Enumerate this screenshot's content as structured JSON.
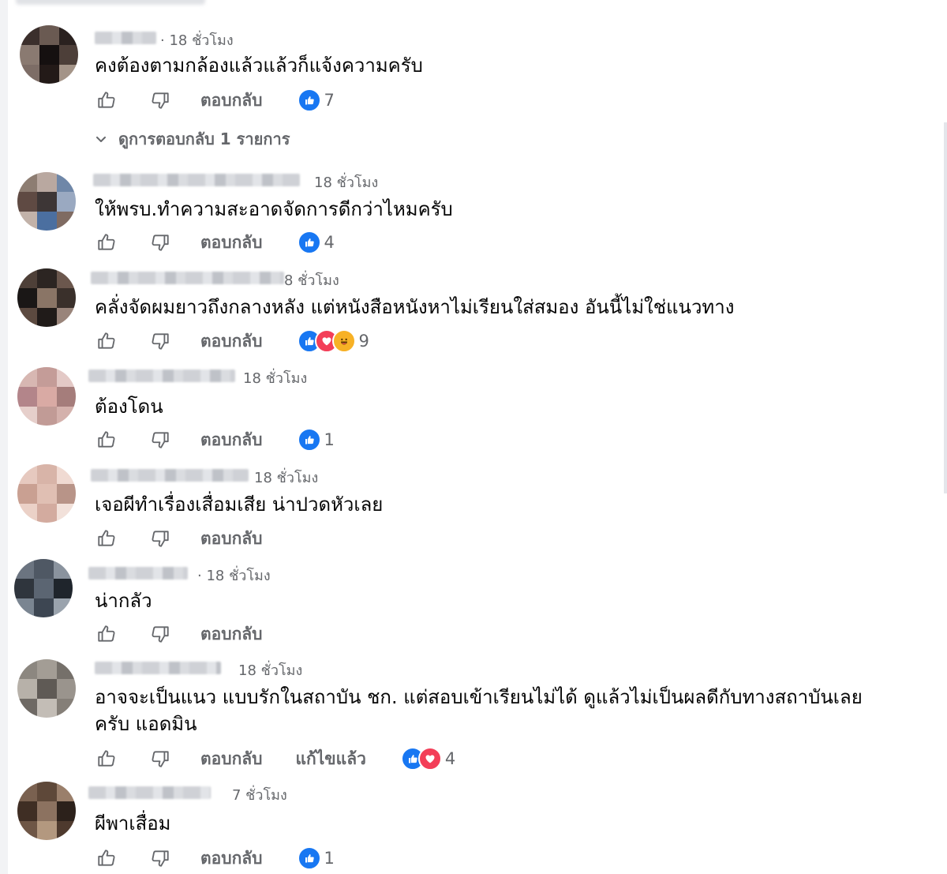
{
  "colors": {
    "accent": "#1877f2",
    "love": "#f33e58",
    "haha": "#f7b125",
    "muted": "#65676b"
  },
  "actions": {
    "like_icon": "thumbs-up-outline-icon",
    "dislike_icon": "thumbs-down-outline-icon",
    "reply": "ตอบกลับ",
    "edited": "แก้ไขแล้ว"
  },
  "view_replies": {
    "icon": "chevron-down-icon",
    "label": "ดูการตอบกลับ 1 รายการ"
  },
  "comments": [
    {
      "time": "· 18 ชั่วโมง",
      "text": "คงต้องตามกล้องแล้วแล้วก็แจ้งความครับ",
      "reactions": [
        "like"
      ],
      "count": "7"
    },
    {
      "time": "18 ชั่วโมง",
      "text": "ให้พรบ.ทำความสะอาดจัดการดีกว่าไหมครับ",
      "reactions": [
        "like"
      ],
      "count": "4"
    },
    {
      "time": "8 ชั่วโมง",
      "text": "คลั่งจัดผมยาวถึงกลางหลัง แต่หนังสือหนังหาไม่เรียนใส่สมอง อันนี้ไม่ใช่แนวทาง",
      "reactions": [
        "like",
        "love",
        "haha"
      ],
      "count": "9"
    },
    {
      "time": "18 ชั่วโมง",
      "text": "ต้องโดน",
      "reactions": [
        "like"
      ],
      "count": "1"
    },
    {
      "time": "18 ชั่วโมง",
      "text": "เจอผีทำเรื่องเสื่อมเสีย น่าปวดหัวเลย",
      "reactions": [],
      "count": ""
    },
    {
      "time": "· 18 ชั่วโมง",
      "text": "น่ากลัว",
      "reactions": [],
      "count": ""
    },
    {
      "time": "18 ชั่วโมง",
      "text": "อาจจะเป็นแนว แบบรักในสถาบัน ชก. แต่สอบเข้าเรียนไม่ได้ ดูแล้วไม่เป็นผลดีกับทางสถาบันเลย",
      "text2": "ครับ แอดมิน",
      "edited": true,
      "reactions": [
        "like",
        "love"
      ],
      "count": "4"
    },
    {
      "time": "7 ชั่วโมง",
      "text": "ผีพาเสื่อม",
      "reactions": [
        "like"
      ],
      "count": "1"
    }
  ]
}
